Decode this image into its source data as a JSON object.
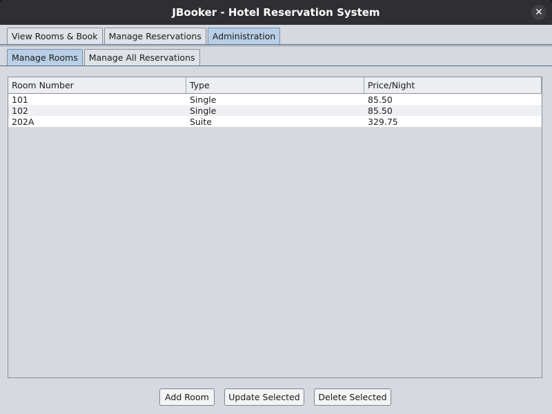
{
  "window": {
    "title": "JBooker - Hotel Reservation System",
    "close_symbol": "✕"
  },
  "main_tabs": [
    {
      "label": "View Rooms & Book",
      "selected": false
    },
    {
      "label": "Manage Reservations",
      "selected": false
    },
    {
      "label": "Administration",
      "selected": true
    }
  ],
  "sub_tabs": [
    {
      "label": "Manage Rooms",
      "selected": true
    },
    {
      "label": "Manage All Reservations",
      "selected": false
    }
  ],
  "rooms_table": {
    "columns": [
      "Room Number",
      "Type",
      "Price/Night"
    ],
    "rows": [
      [
        "101",
        "Single",
        "85.50"
      ],
      [
        "102",
        "Single",
        "85.50"
      ],
      [
        "202A",
        "Suite",
        "329.75"
      ]
    ]
  },
  "buttons": {
    "add": "Add Room",
    "update": "Update Selected",
    "delete": "Delete Selected"
  },
  "colors": {
    "titlebar": "#2f2f33",
    "selected_tab": "#b8cfe5",
    "window_bg": "#d6d9df"
  }
}
